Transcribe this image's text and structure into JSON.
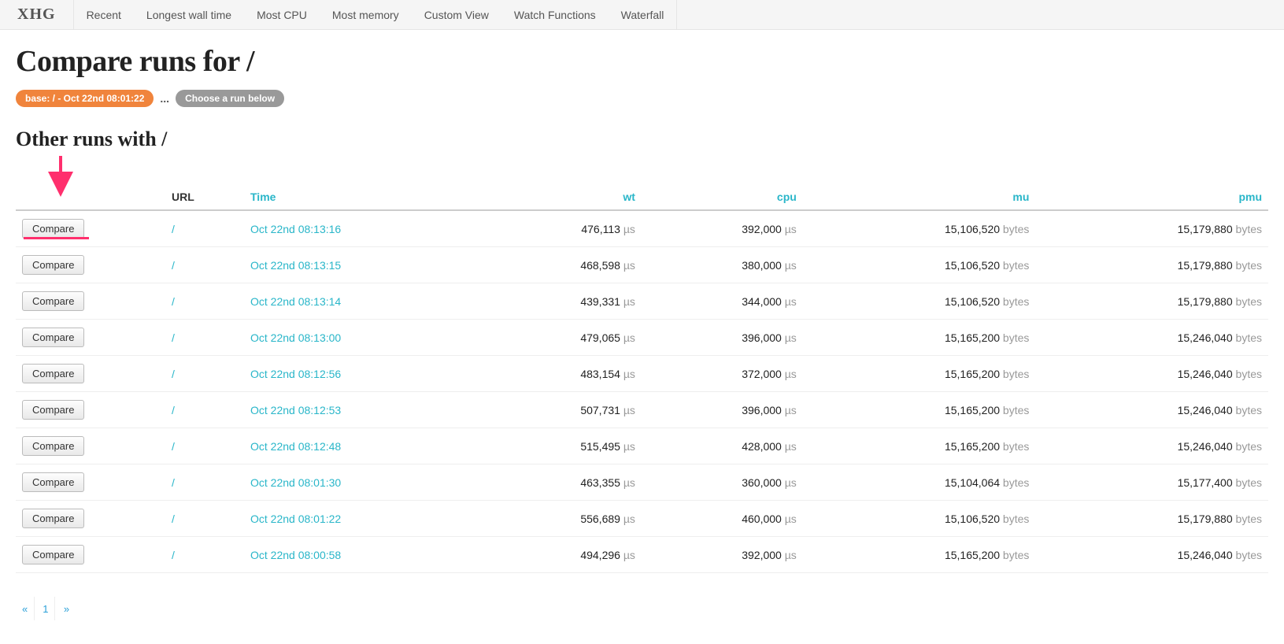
{
  "brand": "XHG",
  "nav": [
    "Recent",
    "Longest wall time",
    "Most CPU",
    "Most memory",
    "Custom View",
    "Watch Functions",
    "Waterfall"
  ],
  "title_prefix": "Compare runs for",
  "title_suffix": "/",
  "base_pill": "base: / - Oct 22nd 08:01:22",
  "ellipsis": "...",
  "choose_pill": "Choose a run below",
  "section_title_prefix": "Other runs with",
  "section_title_suffix": "/",
  "columns": {
    "compare": "",
    "url": "URL",
    "time": "Time",
    "wt": "wt",
    "cpu": "cpu",
    "mu": "mu",
    "pmu": "pmu"
  },
  "compare_label": "Compare",
  "units": {
    "time": "µs",
    "bytes": "bytes"
  },
  "rows": [
    {
      "url": "/",
      "time": "Oct 22nd 08:13:16",
      "wt": "476,113",
      "cpu": "392,000",
      "mu": "15,106,520",
      "pmu": "15,179,880"
    },
    {
      "url": "/",
      "time": "Oct 22nd 08:13:15",
      "wt": "468,598",
      "cpu": "380,000",
      "mu": "15,106,520",
      "pmu": "15,179,880"
    },
    {
      "url": "/",
      "time": "Oct 22nd 08:13:14",
      "wt": "439,331",
      "cpu": "344,000",
      "mu": "15,106,520",
      "pmu": "15,179,880"
    },
    {
      "url": "/",
      "time": "Oct 22nd 08:13:00",
      "wt": "479,065",
      "cpu": "396,000",
      "mu": "15,165,200",
      "pmu": "15,246,040"
    },
    {
      "url": "/",
      "time": "Oct 22nd 08:12:56",
      "wt": "483,154",
      "cpu": "372,000",
      "mu": "15,165,200",
      "pmu": "15,246,040"
    },
    {
      "url": "/",
      "time": "Oct 22nd 08:12:53",
      "wt": "507,731",
      "cpu": "396,000",
      "mu": "15,165,200",
      "pmu": "15,246,040"
    },
    {
      "url": "/",
      "time": "Oct 22nd 08:12:48",
      "wt": "515,495",
      "cpu": "428,000",
      "mu": "15,165,200",
      "pmu": "15,246,040"
    },
    {
      "url": "/",
      "time": "Oct 22nd 08:01:30",
      "wt": "463,355",
      "cpu": "360,000",
      "mu": "15,104,064",
      "pmu": "15,177,400"
    },
    {
      "url": "/",
      "time": "Oct 22nd 08:01:22",
      "wt": "556,689",
      "cpu": "460,000",
      "mu": "15,106,520",
      "pmu": "15,179,880"
    },
    {
      "url": "/",
      "time": "Oct 22nd 08:00:58",
      "wt": "494,296",
      "cpu": "392,000",
      "mu": "15,165,200",
      "pmu": "15,246,040"
    }
  ],
  "pager": {
    "prev": "«",
    "page": "1",
    "next": "»"
  }
}
